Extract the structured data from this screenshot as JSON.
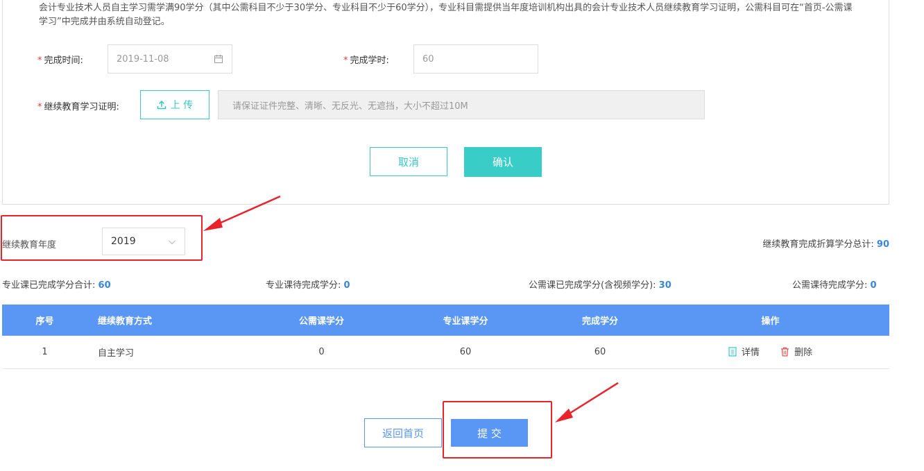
{
  "form": {
    "notice": "会计专业技术人员自主学习需学满90学分（其中公需科目不少于30学分、专业科目不少于60学分），专业科目需提供当年度培训机构出具的会计专业技术人员继续教育学习证明，公需科目可在“首页-公需课学习”中完成并由系统自动登记。",
    "required_mark": "*",
    "date_label": "完成时间:",
    "date_value": "2019-11-08",
    "hours_label": "完成学时:",
    "hours_value": "60",
    "cert_label": "继续教育学习证明:",
    "upload_label": "上 传",
    "upload_hint": "请保证证件完整、清晰、无反光、无遮挡，大小不超过10M",
    "cancel_label": "取消",
    "confirm_label": "确认"
  },
  "year": {
    "label": "继续教育年度",
    "value": "2019"
  },
  "stats": {
    "total_label": "继续教育完成折算学分总计:",
    "total_value": "90",
    "prof_done_label": "专业课已完成学分合计:",
    "prof_done_value": "60",
    "prof_pending_label": "专业课待完成学分:",
    "prof_pending_value": "0",
    "public_done_label": "公需课已完成学分(含视频学分):",
    "public_done_value": "30",
    "public_pending_label": "公需课待完成学分:",
    "public_pending_value": "0"
  },
  "table": {
    "headers": [
      "序号",
      "继续教育方式",
      "公需课学分",
      "专业课学分",
      "完成学分",
      "操作"
    ],
    "rows": [
      {
        "index": "1",
        "method": "自主学习",
        "public": "0",
        "prof": "60",
        "done": "60",
        "detail": "详情",
        "delete": "删除"
      }
    ]
  },
  "footer": {
    "home_label": "返回首页",
    "submit_label": "提 交"
  },
  "colors": {
    "accent_teal": "#39cdc8",
    "table_header": "#5a97f5",
    "highlight_red": "#e8232b",
    "value_blue": "#3a86d8"
  },
  "icons": [
    "calendar-icon",
    "upload-icon",
    "chevron-down-icon",
    "document-icon",
    "trash-icon"
  ]
}
